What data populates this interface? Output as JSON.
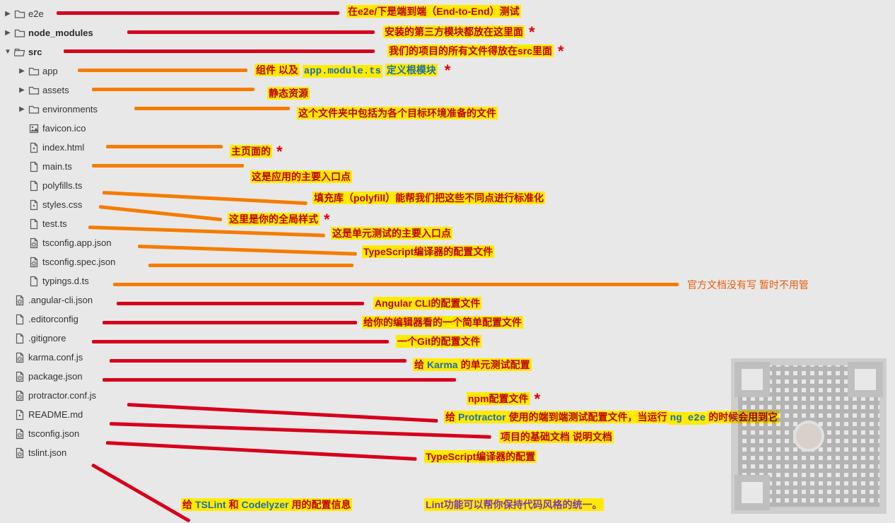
{
  "tree": {
    "e2e": "e2e",
    "node_modules": "node_modules",
    "src": "src",
    "app": "app",
    "assets": "assets",
    "environments": "environments",
    "favicon": "favicon.ico",
    "index": "index.html",
    "main": "main.ts",
    "polyfills": "polyfills.ts",
    "styles": "styles.css",
    "test": "test.ts",
    "tsconfig_app": "tsconfig.app.json",
    "tsconfig_spec": "tsconfig.spec.json",
    "typings": "typings.d.ts",
    "angular_cli": ".angular-cli.json",
    "editorconfig": ".editorconfig",
    "gitignore": ".gitignore",
    "karma": "karma.conf.js",
    "package": "package.json",
    "protractor": "protractor.conf.js",
    "readme": "README.md",
    "tsconfig": "tsconfig.json",
    "tslint": "tslint.json"
  },
  "ann": {
    "e2e": "在e2e/下是端到端（End-to-End）测试",
    "node_modules": "安装的第三方模块都放在这里面",
    "src": "我们的项目的所有文件得放在src里面",
    "app_pre": "组件   以及",
    "app_code": "app.module.ts",
    "app_post": " 定义根模块",
    "assets": "静态资源",
    "environments": "这个文件夹中包括为各个目标环境准备的文件",
    "index": "主页面的",
    "main": "这是应用的主要入口点",
    "polyfills": "填充库（polyfill）能帮我们把这些不同点进行标准化",
    "styles": "这里是你的全局样式",
    "test": "这是单元测试的主要入口点",
    "tsconfig_app": "TypeScript编译器的配置文件",
    "typings": "官方文档没有写   暂时不用管",
    "angular_cli": "Angular CLI的配置文件",
    "editorconfig": "给你的编辑器看的一个简单配置文件",
    "gitignore": "一个Git的配置文件",
    "karma_pre": "给",
    "karma_link": "Karma",
    "karma_post": "的单元测试配置",
    "package": "npm配置文件",
    "protractor_pre": "给",
    "protractor_link": "Protractor",
    "protractor_post": "使用的端到端测试配置文件，当运行",
    "protractor_code": "ng  e2e",
    "protractor_end": "的时候会用到它",
    "readme": "项目的基础文档  说明文档",
    "tsconfig": "TypeScript编译器的配置",
    "tslint_pre": "给",
    "tslint_link1": "TSLint",
    "tslint_mid": "和",
    "tslint_link2": "Codelyzer",
    "tslint_post": "用的配置信息",
    "tslint_extra": "Lint功能可以帮你保持代码风格的统一。"
  }
}
